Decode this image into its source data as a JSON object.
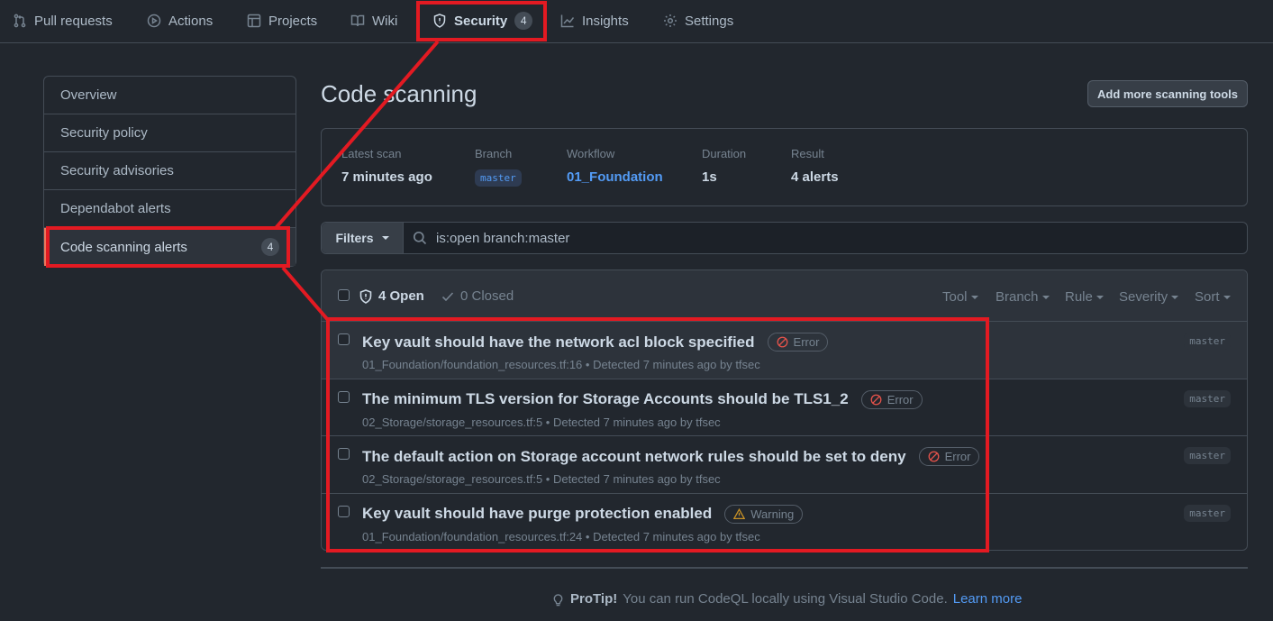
{
  "nav": {
    "tabs": [
      {
        "label": "Pull requests",
        "icon": "pull-request-icon"
      },
      {
        "label": "Actions",
        "icon": "play-icon"
      },
      {
        "label": "Projects",
        "icon": "table-icon"
      },
      {
        "label": "Wiki",
        "icon": "book-icon"
      },
      {
        "label": "Security",
        "icon": "shield-icon",
        "count": "4",
        "active": true
      },
      {
        "label": "Insights",
        "icon": "graph-icon"
      },
      {
        "label": "Settings",
        "icon": "gear-icon"
      }
    ]
  },
  "sidebar": {
    "items": [
      {
        "label": "Overview"
      },
      {
        "label": "Security policy"
      },
      {
        "label": "Security advisories"
      },
      {
        "label": "Dependabot alerts"
      },
      {
        "label": "Code scanning alerts",
        "count": "4",
        "active": true
      }
    ]
  },
  "page": {
    "title": "Code scanning",
    "add_tools_label": "Add more scanning tools"
  },
  "scan": {
    "latest_label": "Latest scan",
    "latest_value": "7 minutes ago",
    "branch_label": "Branch",
    "branch_value": "master",
    "workflow_label": "Workflow",
    "workflow_value": "01_Foundation",
    "duration_label": "Duration",
    "duration_value": "1s",
    "result_label": "Result",
    "result_value": "4 alerts"
  },
  "filter": {
    "button_label": "Filters",
    "query": "is:open branch:master"
  },
  "alerts": {
    "open_label": "4 Open",
    "closed_label": "0 Closed",
    "filters": [
      "Tool",
      "Branch",
      "Rule",
      "Severity",
      "Sort"
    ],
    "rows": [
      {
        "title": "Key vault should have the network acl block specified",
        "severity": "Error",
        "meta": "01_Foundation/foundation_resources.tf:16 • Detected 7 minutes ago by tfsec",
        "branch": "master"
      },
      {
        "title": "The minimum TLS version for Storage Accounts should be TLS1_2",
        "severity": "Error",
        "meta": "02_Storage/storage_resources.tf:5 • Detected 7 minutes ago by tfsec",
        "branch": "master"
      },
      {
        "title": "The default action on Storage account network rules should be set to deny",
        "severity": "Error",
        "meta": "02_Storage/storage_resources.tf:5 • Detected 7 minutes ago by tfsec",
        "branch": "master"
      },
      {
        "title": "Key vault should have purge protection enabled",
        "severity": "Warning",
        "meta": "01_Foundation/foundation_resources.tf:24 • Detected 7 minutes ago by tfsec",
        "branch": "master"
      }
    ]
  },
  "protip": {
    "label": "ProTip!",
    "text": "You can run CodeQL locally using Visual Studio Code.",
    "link": "Learn more"
  },
  "colors": {
    "background": "#22272e",
    "accent_link": "#539bf5",
    "error": "#e5534b",
    "warning": "#c69026",
    "annotation": "#e31a22"
  }
}
